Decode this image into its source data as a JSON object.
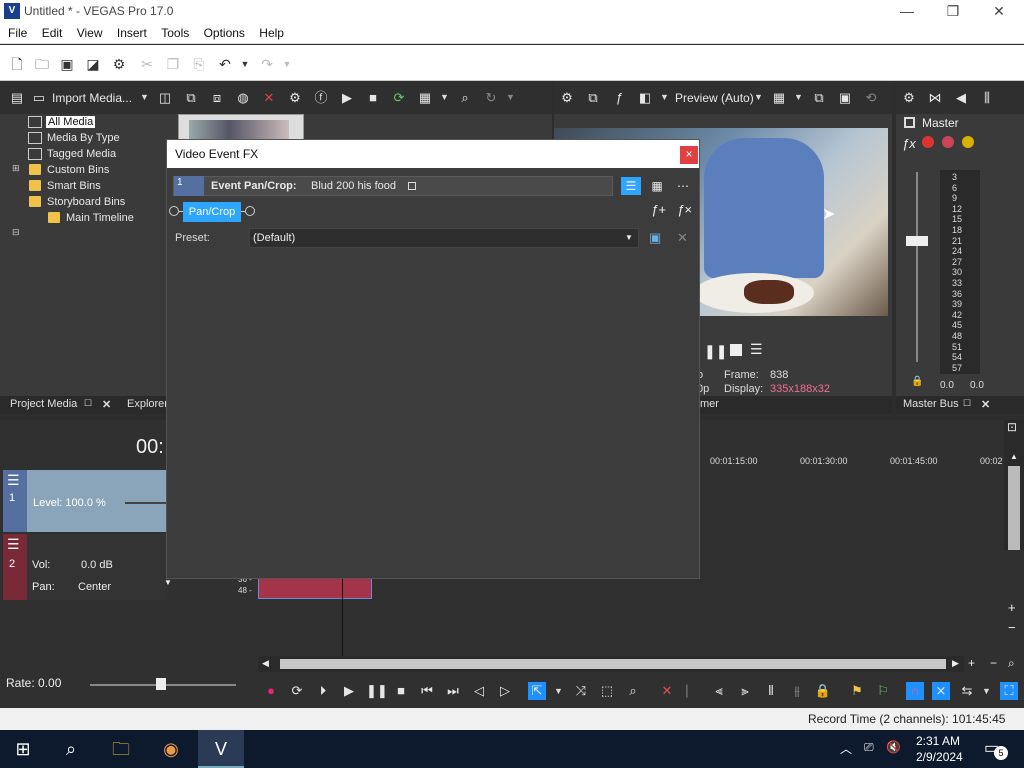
{
  "window": {
    "title": "Untitled * - VEGAS Pro 17.0",
    "app_icon": "V",
    "min": "—",
    "max": "❐",
    "close": "✕"
  },
  "menu": [
    "File",
    "Edit",
    "View",
    "Insert",
    "Tools",
    "Options",
    "Help"
  ],
  "media_toolbar": {
    "import_label": "Import Media..."
  },
  "media_tree": {
    "items": [
      "All Media",
      "Media By Type",
      "Tagged Media",
      "Custom Bins",
      "Smart Bins",
      "Storyboard Bins",
      "Main Timeline"
    ]
  },
  "left_tabs": {
    "project_media": "Project Media",
    "explorer": "Explorer"
  },
  "preview": {
    "quality": "Preview (Auto)",
    "frame_label": "Frame:",
    "frame_value": "838",
    "display_label": "Display:",
    "display_value": "335x188x32",
    "left_cut_1": "o",
    "left_cut_2": "0p",
    "tab_cut": "mer"
  },
  "master": {
    "title": "Master",
    "scale": [
      "3",
      "6",
      "9",
      "12",
      "15",
      "18",
      "21",
      "24",
      "27",
      "30",
      "33",
      "36",
      "39",
      "42",
      "45",
      "48",
      "51",
      "54",
      "57"
    ],
    "left_val": "0.0",
    "right_val": "0.0",
    "tab": "Master Bus"
  },
  "dialog": {
    "title": "Video Event FX",
    "close": "×",
    "chain_label": "Event Pan/Crop:",
    "chain_name": "Blud 200 his food",
    "plugin_tab": "Pan/Crop",
    "preset_label": "Preset:",
    "preset_value": "(Default)"
  },
  "timeline": {
    "timecode_cut": "00:",
    "ruler": [
      "00:01:15:00",
      "00:01:30:00",
      "00:01:45:00",
      "00:02"
    ],
    "track1": {
      "number": "1",
      "level_label": "Level: 100.0 %"
    },
    "track2": {
      "number": "2",
      "vol_label": "Vol:",
      "vol_value": "0.0 dB",
      "pan_label": "Pan:",
      "pan_value": "Center",
      "cut_num_1": "36 -",
      "cut_num_2": "48 -"
    },
    "rate": "Rate: 0.00"
  },
  "status": {
    "record_time": "Record Time (2 channels): 101:45:45"
  },
  "taskbar": {
    "time": "2:31 AM",
    "date": "2/9/2024",
    "notif_count": "5"
  },
  "colors": {
    "accent": "#1e90ff",
    "chain_blue": "#2ea6ff",
    "track1": "#8aa4b9",
    "track2_header": "#7a2a36",
    "event_red": "#a3344a"
  }
}
